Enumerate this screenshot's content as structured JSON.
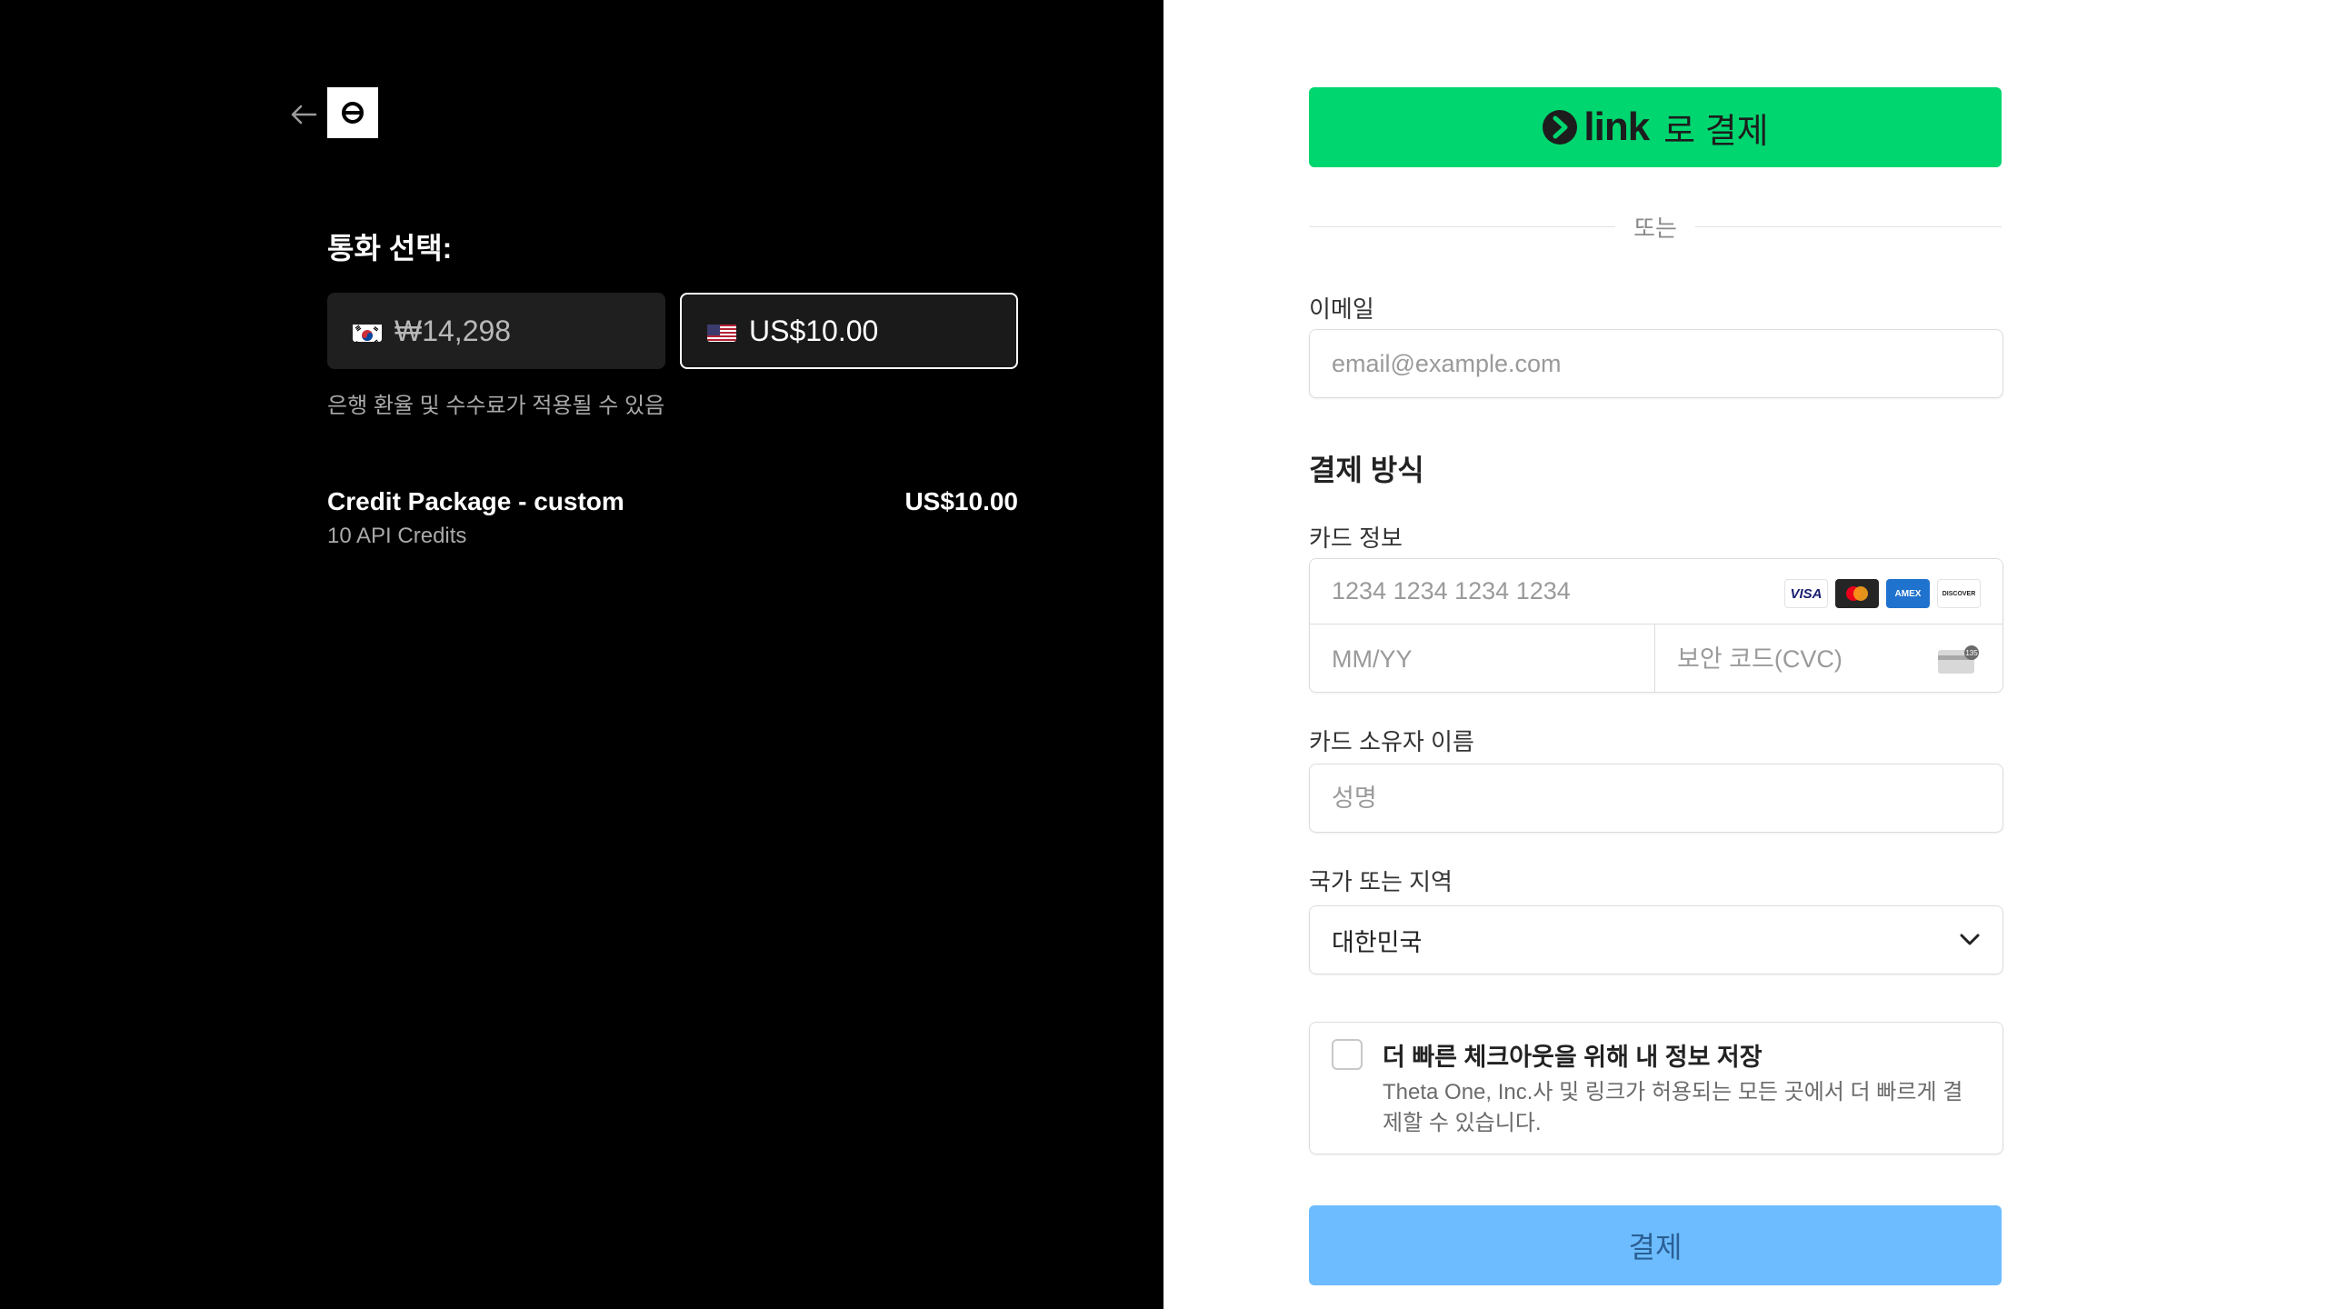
{
  "left": {
    "title": "통화 선택:",
    "currencies": [
      {
        "code": "KRW",
        "amount": "₩14,298"
      },
      {
        "code": "USD",
        "amount": "US$10.00"
      }
    ],
    "fee_note": "은행 환율 및 수수료가 적용될 수 있음",
    "product": {
      "name": "Credit Package - custom",
      "sub": "10 API Credits",
      "price": "US$10.00"
    }
  },
  "right": {
    "link_button": {
      "word": "link",
      "suffix": "로 결제"
    },
    "divider": "또는",
    "email": {
      "label": "이메일",
      "placeholder": "email@example.com"
    },
    "payment_section": "결제 방식",
    "card": {
      "label": "카드 정보",
      "number_placeholder": "1234 1234 1234 1234",
      "expiry_placeholder": "MM/YY",
      "cvc_placeholder": "보안 코드(CVC)",
      "brands": [
        "VISA",
        "mastercard",
        "AMEX",
        "DISCOVER"
      ]
    },
    "cardholder": {
      "label": "카드 소유자 이름",
      "placeholder": "성명"
    },
    "country": {
      "label": "국가 또는 지역",
      "value": "대한민국"
    },
    "save_info": {
      "title": "더 빠른 체크아웃을 위해 내 정보 저장",
      "desc": "Theta One, Inc.사 및 링크가 허용되는 모든 곳에서 더 빠르게 결제할 수 있습니다."
    },
    "pay_label": "결제"
  },
  "colors": {
    "link_green": "#00d66f",
    "pay_blue": "#6cbcff"
  }
}
